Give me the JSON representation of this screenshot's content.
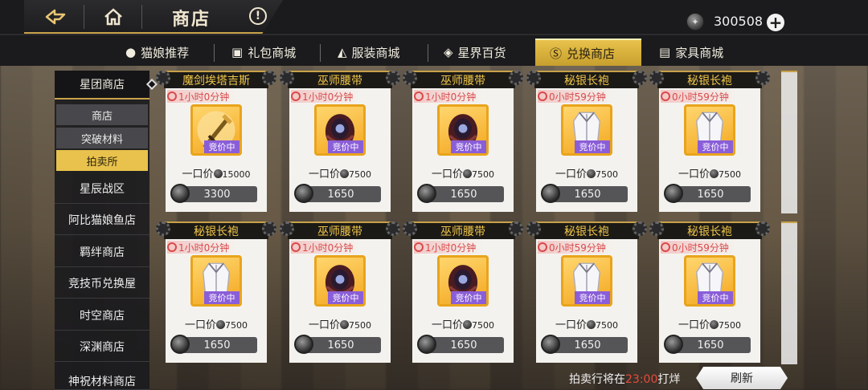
{
  "header": {
    "title": "商店",
    "currency_amount": "300508",
    "icons": [
      "back-arrow-icon",
      "home-icon",
      "info-icon",
      "coin-icon",
      "plus-icon"
    ]
  },
  "tabs": [
    {
      "label": "猫娘推荐",
      "icon": "cat-icon"
    },
    {
      "label": "礼包商城",
      "icon": "gift-icon"
    },
    {
      "label": "服装商城",
      "icon": "clothes-icon"
    },
    {
      "label": "星界百货",
      "icon": "drop-icon"
    },
    {
      "label": "兑换商店",
      "icon": "exchange-coin-icon",
      "active": true
    },
    {
      "label": "家具商城",
      "icon": "bed-icon"
    }
  ],
  "sidebar": {
    "header": "星团商店",
    "subitems": [
      {
        "label": "商店"
      },
      {
        "label": "突破材料"
      },
      {
        "label": "拍卖所",
        "active": true
      }
    ],
    "items": [
      {
        "label": "星辰战区"
      },
      {
        "label": "阿比猫娘鱼店"
      },
      {
        "label": "羁绊商店"
      },
      {
        "label": "竞技币兑换屋"
      },
      {
        "label": "时空商店"
      },
      {
        "label": "深渊商店"
      },
      {
        "label": "神祝材料商店"
      }
    ]
  },
  "auction": {
    "price_prefix": "一口价",
    "status_badge": "竞价中",
    "items": [
      {
        "name": "魔剑埃塔吉斯",
        "timer": "1小时0分钟",
        "buyout": "15000",
        "bid": "3300",
        "icon": "sword-icon"
      },
      {
        "name": "巫师腰带",
        "timer": "1小时0分钟",
        "buyout": "7500",
        "bid": "1650",
        "icon": "belt-icon"
      },
      {
        "name": "巫师腰带",
        "timer": "1小时0分钟",
        "buyout": "7500",
        "bid": "1650",
        "icon": "belt-icon"
      },
      {
        "name": "秘银长袍",
        "timer": "0小时59分钟",
        "buyout": "7500",
        "bid": "1650",
        "icon": "robe-icon"
      },
      {
        "name": "秘银长袍",
        "timer": "0小时59分钟",
        "buyout": "7500",
        "bid": "1650",
        "icon": "robe-icon"
      },
      {
        "name": "秘银长袍",
        "timer": "1小时0分钟",
        "buyout": "7500",
        "bid": "1650",
        "icon": "robe-icon"
      },
      {
        "name": "巫师腰带",
        "timer": "1小时0分钟",
        "buyout": "7500",
        "bid": "1650",
        "icon": "belt-icon"
      },
      {
        "name": "巫师腰带",
        "timer": "1小时0分钟",
        "buyout": "7500",
        "bid": "1650",
        "icon": "belt-icon"
      },
      {
        "name": "秘银长袍",
        "timer": "0小时59分钟",
        "buyout": "7500",
        "bid": "1650",
        "icon": "robe-icon"
      },
      {
        "name": "秘银长袍",
        "timer": "0小时59分钟",
        "buyout": "7500",
        "bid": "1650",
        "icon": "robe-icon"
      }
    ]
  },
  "footer": {
    "refresh_note_prefix": "拍卖行将在",
    "refresh_time": "23:00",
    "refresh_note_suffix": "打烊",
    "refresh_label": "刷新"
  },
  "colors": {
    "accent_gold": "#e8c24c",
    "timer_red": "#d94a4a",
    "badge_purple": "#8a5ed8",
    "item_frame_orange": "#e9a41c"
  }
}
